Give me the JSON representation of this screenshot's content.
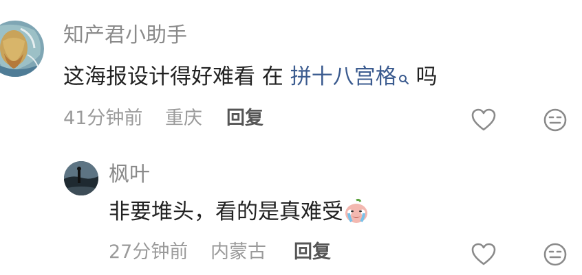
{
  "comment": {
    "username": "知产君小助手",
    "text_before_link": "这海报设计得好难看 在 ",
    "link_text": "拼十八宫格",
    "text_after_link": " 吗",
    "time": "41分钟前",
    "location": "重庆",
    "reply_label": "回复",
    "avatar_icon": "van-gogh-portrait-avatar",
    "like_icon": "heart-outline-icon",
    "emoji_icon": "emoji-face-icon",
    "search_icon": "search-icon"
  },
  "reply": {
    "username": "枫叶",
    "text": "非要堆头，看的是真难受",
    "emoji": "crying-face-emoji",
    "time": "27分钟前",
    "location": "内蒙古",
    "reply_label": "回复",
    "avatar_icon": "dark-landscape-avatar",
    "like_icon": "heart-outline-icon",
    "emoji_icon": "emoji-face-icon"
  },
  "colors": {
    "link": "#3b5b8f",
    "meta": "#9a9a9a",
    "username": "#8a8a8a",
    "text": "#222222"
  }
}
